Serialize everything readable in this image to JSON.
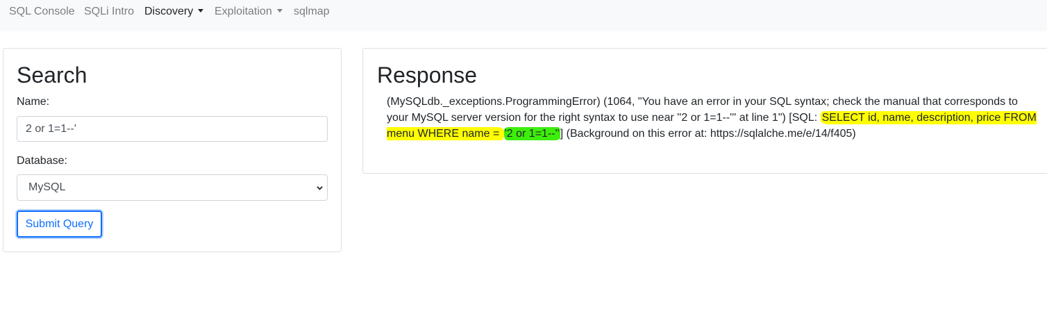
{
  "nav": {
    "items": [
      {
        "label": "SQL Console"
      },
      {
        "label": "SQLi Intro"
      },
      {
        "label": "Discovery"
      },
      {
        "label": "Exploitation"
      },
      {
        "label": "sqlmap"
      }
    ]
  },
  "search": {
    "title": "Search",
    "name_label": "Name:",
    "name_value": "2 or 1=1--'",
    "database_label": "Database:",
    "database_selected": "MySQL",
    "submit_label": "Submit Query"
  },
  "response": {
    "title": "Response",
    "text_part1": "(MySQLdb._exceptions.ProgrammingError) (1064, \"You have an error in your SQL syntax; check the manual that corresponds to your MySQL server version for the right syntax to use near ''2 or 1=1--''' at line 1\") [SQL: ",
    "sql_query": "SELECT id, name, description, price FROM menu WHERE name = ",
    "sql_value": "'2 or 1=1--''",
    "text_part2": "] (Background on this error at: https://sqlalche.me/e/14/f405)"
  },
  "colors": {
    "nav_bg": "#f8f9fa",
    "primary": "#0d6efd",
    "highlight_yellow": "#ffff00",
    "highlight_green": "#3ded0b"
  }
}
